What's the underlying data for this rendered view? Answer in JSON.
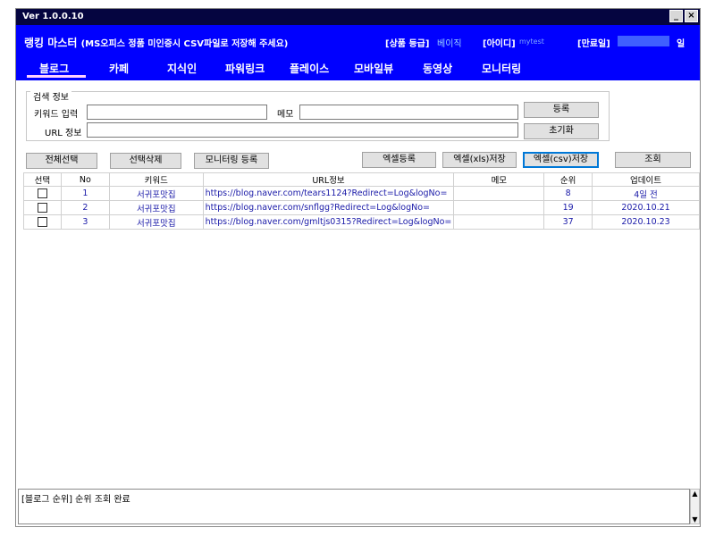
{
  "window": {
    "version": "Ver 1.0.0.10",
    "minimize": "_",
    "close": "×"
  },
  "header": {
    "title": "랭킹 마스터",
    "subtitle": "(MS오피스 정품 미인증시 CSV파일로 저장해 주세요)",
    "grade_label": "[상품 등급]",
    "grade_value": "베이직",
    "id_label": "[아이디]",
    "id_value": "mytest",
    "expiry_label": "[만료일]",
    "expiry_suffix": "일"
  },
  "tabs": [
    "블로그",
    "카페",
    "지식인",
    "파워링크",
    "플레이스",
    "모바일뷰",
    "동영상",
    "모니터링"
  ],
  "search": {
    "legend": "검색 정보",
    "keyword_label": "키워드 입력",
    "memo_label": "메모",
    "url_label": "URL 정보",
    "keyword_value": "",
    "memo_value": "",
    "url_value": "",
    "register_button": "등록",
    "reset_button": "초기화"
  },
  "toolbar": {
    "select_all": "전체선택",
    "delete_selected": "선택삭제",
    "register_monitoring": "모니터링 등록",
    "excel_register": "엑셀등록",
    "excel_xls_save": "엑셀(xls)저장",
    "excel_csv_save": "엑셀(csv)저장",
    "query": "조회"
  },
  "table": {
    "columns": [
      "선택",
      "No",
      "키워드",
      "URL정보",
      "메모",
      "순위",
      "업데이트"
    ],
    "rows": [
      {
        "no": "1",
        "keyword": "서귀포맛집",
        "url": "https://blog.naver.com/tears1124?Redirect=Log&logNo=",
        "memo": "",
        "rank": "8",
        "updated": "4일 전"
      },
      {
        "no": "2",
        "keyword": "서귀포맛집",
        "url": "https://blog.naver.com/snflgg?Redirect=Log&logNo=",
        "memo": "",
        "rank": "19",
        "updated": "2020.10.21"
      },
      {
        "no": "3",
        "keyword": "서귀포맛집",
        "url": "https://blog.naver.com/gmltjs0315?Redirect=Log&logNo=",
        "memo": "",
        "rank": "37",
        "updated": "2020.10.23"
      }
    ]
  },
  "status": {
    "message": "[블로그 순위] 순위 조회 완료"
  },
  "colors": {
    "header_bg": "#0000ff",
    "titlebar_bg": "#050540",
    "row_text": "#1a1aa8"
  }
}
